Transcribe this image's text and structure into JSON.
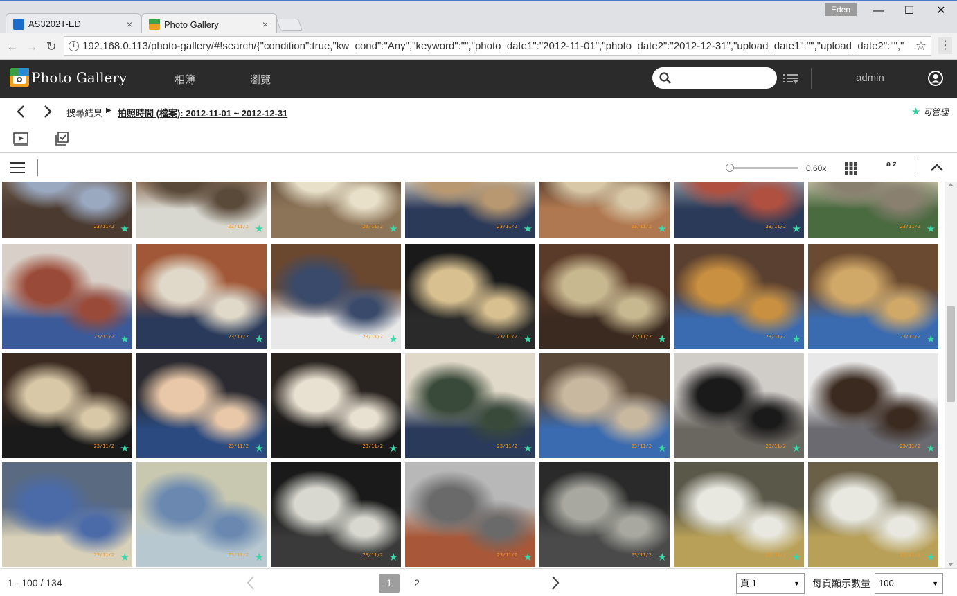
{
  "browser": {
    "tabs": [
      {
        "title": "AS3202T-ED",
        "close": "×"
      },
      {
        "title": "Photo Gallery",
        "close": "×"
      }
    ],
    "profile": "Eden",
    "window_controls": {
      "minimize": "—",
      "maximize": "☐",
      "close": "✕"
    },
    "url": "192.168.0.113/photo-gallery/#!search/{\"condition\":true,\"kw_cond\":\"Any\",\"keyword\":\"\",\"photo_date1\":\"2012-11-01\",\"photo_date2\":\"2012-12-31\",\"upload_date1\":\"\",\"upload_date2\":\"\",\""
  },
  "header": {
    "app_title": "Photo Gallery",
    "nav": [
      "相簿",
      "瀏覽"
    ],
    "search_placeholder": "",
    "user": "admin"
  },
  "breadcrumb": {
    "root": "搜尋結果",
    "separator": "▶",
    "current": "拍照時間 (檔案): 2012-11-01 ~ 2012-12-31",
    "manage_label": "可管理"
  },
  "view": {
    "zoom_value": "0.60x",
    "zoom_fraction": 0.0,
    "sort_label": "a z"
  },
  "photos": {
    "date_stamp": "23/11/2",
    "star": "★",
    "rows": [
      [
        {
          "sky": "#6e5a48",
          "ground": "#4a3a30",
          "accent": "#9aa8c0"
        },
        {
          "sky": "#8a6a52",
          "ground": "#d8d8d0",
          "accent": "#5a4a3a"
        },
        {
          "sky": "#6a5440",
          "ground": "#8c7458",
          "accent": "#e8e0c8"
        },
        {
          "sky": "#d8d0c0",
          "ground": "#2c3a5a",
          "accent": "#b89870"
        },
        {
          "sky": "#5a4030",
          "ground": "#b07850",
          "accent": "#d8c8a8"
        },
        {
          "sky": "#9aa0a8",
          "ground": "#2a3a58",
          "accent": "#b05040"
        },
        {
          "sky": "#c8c0a8",
          "ground": "#4a6a40",
          "accent": "#8a8070"
        }
      ],
      [
        {
          "sky": "#d8d0c8",
          "ground": "#3a5a9a",
          "accent": "#9a4a38"
        },
        {
          "sky": "#a05838",
          "ground": "#2a3a5a",
          "accent": "#e0d8c8"
        },
        {
          "sky": "#6a4830",
          "ground": "#e8e8e8",
          "accent": "#3a4a6a"
        },
        {
          "sky": "#1a1a1a",
          "ground": "#2a2a2a",
          "accent": "#d8c090"
        },
        {
          "sky": "#5a3a28",
          "ground": "#3a2a20",
          "accent": "#c8b890"
        },
        {
          "sky": "#5a4030",
          "ground": "#3a6ab0",
          "accent": "#c89040"
        },
        {
          "sky": "#6a4a30",
          "ground": "#3a6ab0",
          "accent": "#d0a868"
        }
      ],
      [
        {
          "sky": "#3a2a20",
          "ground": "#1a1a1a",
          "accent": "#d8c8a8"
        },
        {
          "sky": "#2a2a30",
          "ground": "#2a4a80",
          "accent": "#e8c8a8"
        },
        {
          "sky": "#2a2420",
          "ground": "#1a1a1a",
          "accent": "#e8e0d0"
        },
        {
          "sky": "#e0d8c8",
          "ground": "#2a3a5a",
          "accent": "#3a4a3a"
        },
        {
          "sky": "#5a4838",
          "ground": "#3a6ab0",
          "accent": "#c8b8a0"
        },
        {
          "sky": "#d0ccc8",
          "ground": "#6a6660",
          "accent": "#1a1a1a"
        },
        {
          "sky": "#e8e8e8",
          "ground": "#6a6a70",
          "accent": "#3a2a20"
        }
      ],
      [
        {
          "sky": "#5a6a80",
          "ground": "#d8d0b8",
          "accent": "#4a6aa8"
        },
        {
          "sky": "#c8c8b0",
          "ground": "#b8c8d0",
          "accent": "#6a88b0"
        },
        {
          "sky": "#1a1a1a",
          "ground": "#3a3a3a",
          "accent": "#d8d8d0"
        },
        {
          "sky": "#b8b8b8",
          "ground": "#a85838",
          "accent": "#6a6a6a"
        },
        {
          "sky": "#2a2a2a",
          "ground": "#4a4a4a",
          "accent": "#a8a8a0"
        },
        {
          "sky": "#5a5848",
          "ground": "#b8a058",
          "accent": "#e8e8e0"
        },
        {
          "sky": "#6a6048",
          "ground": "#b8a058",
          "accent": "#e8e8e0"
        }
      ]
    ]
  },
  "pager": {
    "range": "1 - 100 / 134",
    "pages": [
      "1",
      "2"
    ],
    "current_page": "1",
    "page_select": "頁 1",
    "per_page_label": "每頁顯示數量",
    "per_page_value": "100",
    "caret": "▼"
  },
  "colors": {
    "header_bg": "#2b2b2b",
    "star": "#3cd6a8",
    "date_stamp": "#f29a2a"
  }
}
